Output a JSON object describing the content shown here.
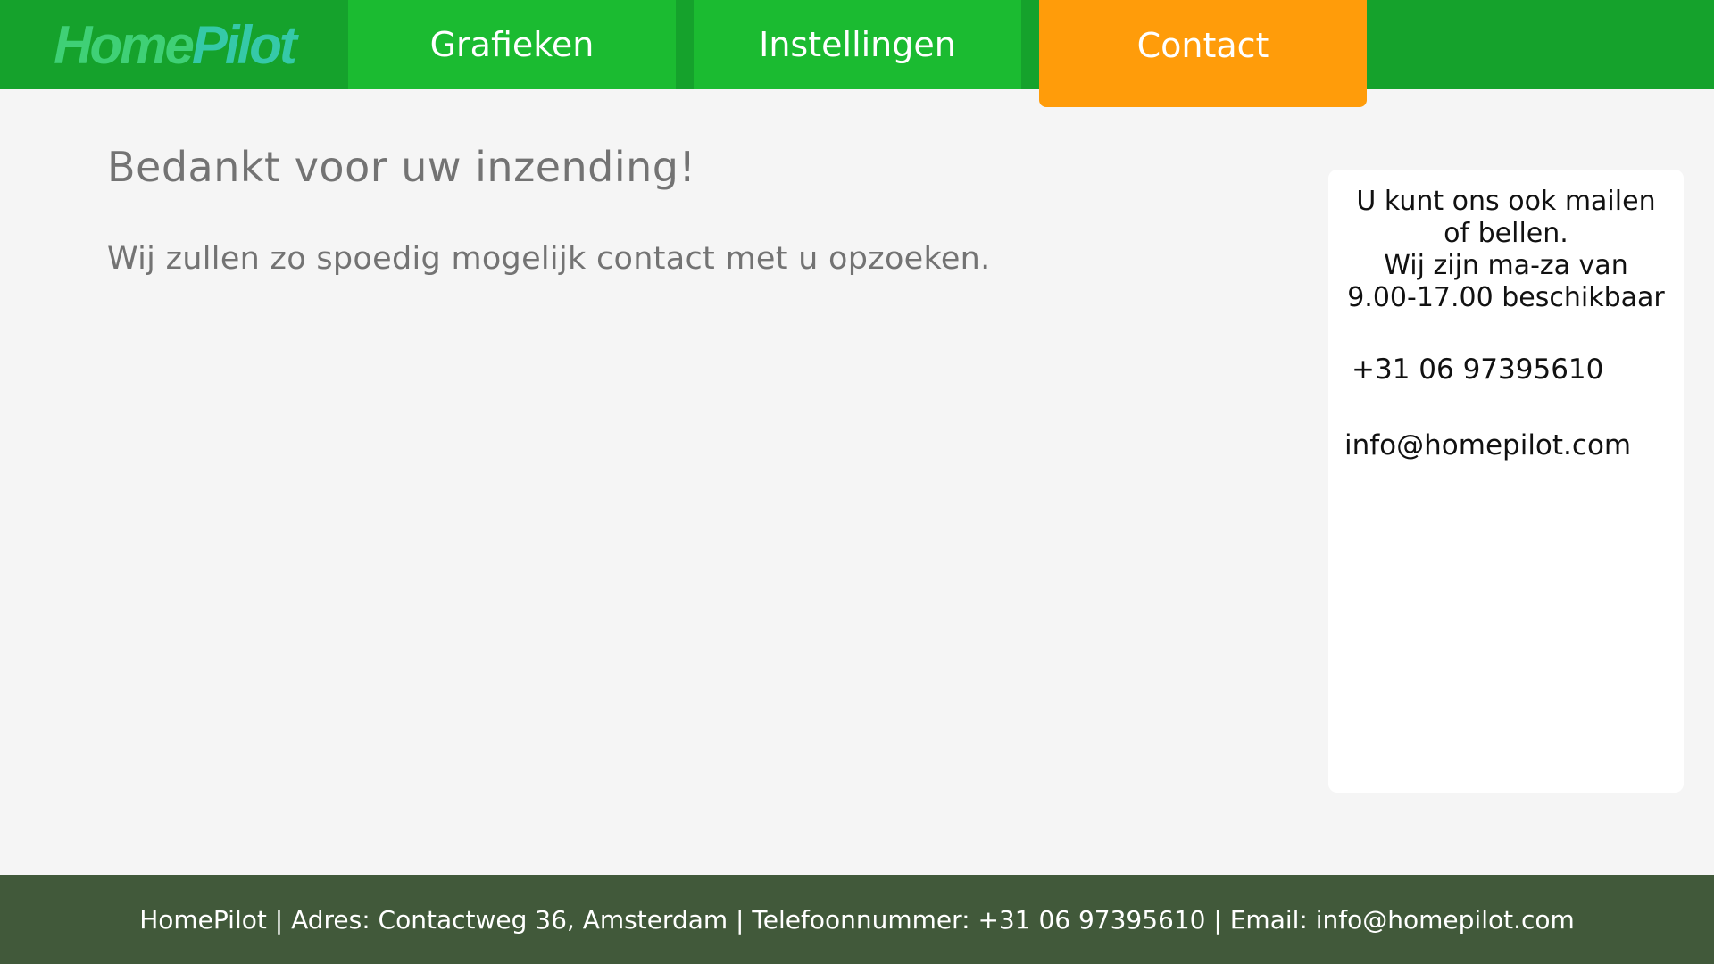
{
  "header": {
    "logo": {
      "part1": "Home",
      "part2": "Pilot"
    },
    "tabs": [
      {
        "label": "Grafieken",
        "active": false
      },
      {
        "label": "Instellingen",
        "active": false
      },
      {
        "label": "Contact",
        "active": true
      }
    ]
  },
  "main": {
    "title": "Bedankt voor uw inzending!",
    "message": "Wij zullen zo spoedig mogelijk contact met u opzoeken."
  },
  "contact_card": {
    "intro_lines": [
      "U kunt ons ook mailen",
      "of bellen.",
      "Wij zijn ma-za van",
      "9.00-17.00 beschikbaar"
    ],
    "phone": "+31 06 97395610",
    "email": "info@homepilot.com"
  },
  "footer": {
    "text": "HomePilot | Adres: Contactweg 36, Amsterdam | Telefoonnummer: +31 06 97395610 | Email: info@homepilot.com"
  },
  "colors": {
    "header_bg": "#15a22c",
    "tab_bg": "#1bbb31",
    "active_tab_bg": "#ff9c0a",
    "footer_bg": "#41593a",
    "logo_home": "#3fd076",
    "logo_pilot": "#35c9a8"
  }
}
